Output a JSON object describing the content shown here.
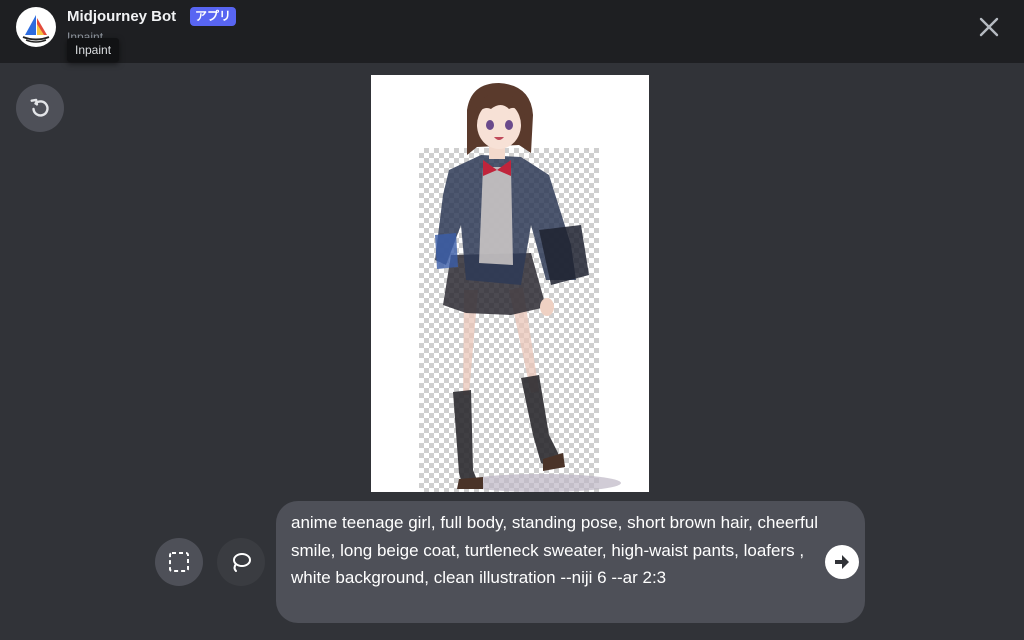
{
  "header": {
    "bot_name": "Midjourney Bot",
    "app_badge": "アプリ",
    "subtitle": "Inpaint",
    "tooltip": "Inpaint",
    "avatar_icon": "sailboat-icon",
    "close_icon": "close-icon"
  },
  "toolbar": {
    "undo_icon": "undo-icon",
    "rect_select_icon": "rectangle-select-icon",
    "lasso_icon": "lasso-icon"
  },
  "prompt": {
    "text": "anime teenage girl, full body, standing pose, short brown hair, cheerful smile, long beige coat, turtleneck sweater, high-waist pants, loafers , white background, clean illustration --niji 6 --ar 2:3",
    "send_icon": "send-arrow-icon"
  },
  "colors": {
    "background": "#313338",
    "topbar": "#1e1f22",
    "badge": "#5865f2",
    "button": "#4e5058"
  }
}
